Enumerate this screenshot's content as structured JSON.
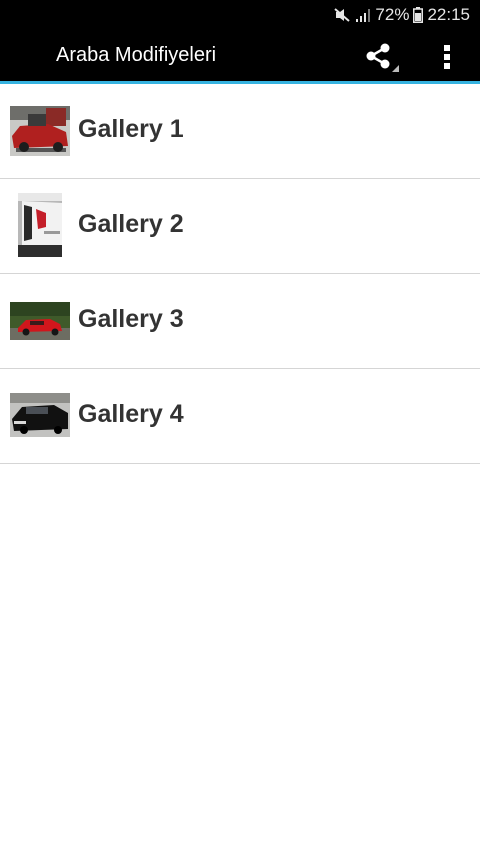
{
  "status_bar": {
    "battery": "72%",
    "time": "22:15",
    "icons": [
      "mute-icon",
      "signal-icon",
      "battery-icon"
    ]
  },
  "app_bar": {
    "title": "Araba Modifiyeleri",
    "actions": [
      "share-icon",
      "overflow-menu-icon"
    ]
  },
  "list": {
    "items": [
      {
        "label": "Gallery 1",
        "thumbnail": "red-car-engine-thumbnail"
      },
      {
        "label": "Gallery 2",
        "thumbnail": "white-car-tail-thumbnail"
      },
      {
        "label": "Gallery 3",
        "thumbnail": "red-car-road-thumbnail"
      },
      {
        "label": "Gallery 4",
        "thumbnail": "black-car-thumbnail"
      }
    ]
  },
  "colors": {
    "status_bar_bg": "#000000",
    "app_bar_bg": "#000000",
    "accent_line": "#36b3e0",
    "item_text": "#333333",
    "divider": "#d5d5d5"
  }
}
